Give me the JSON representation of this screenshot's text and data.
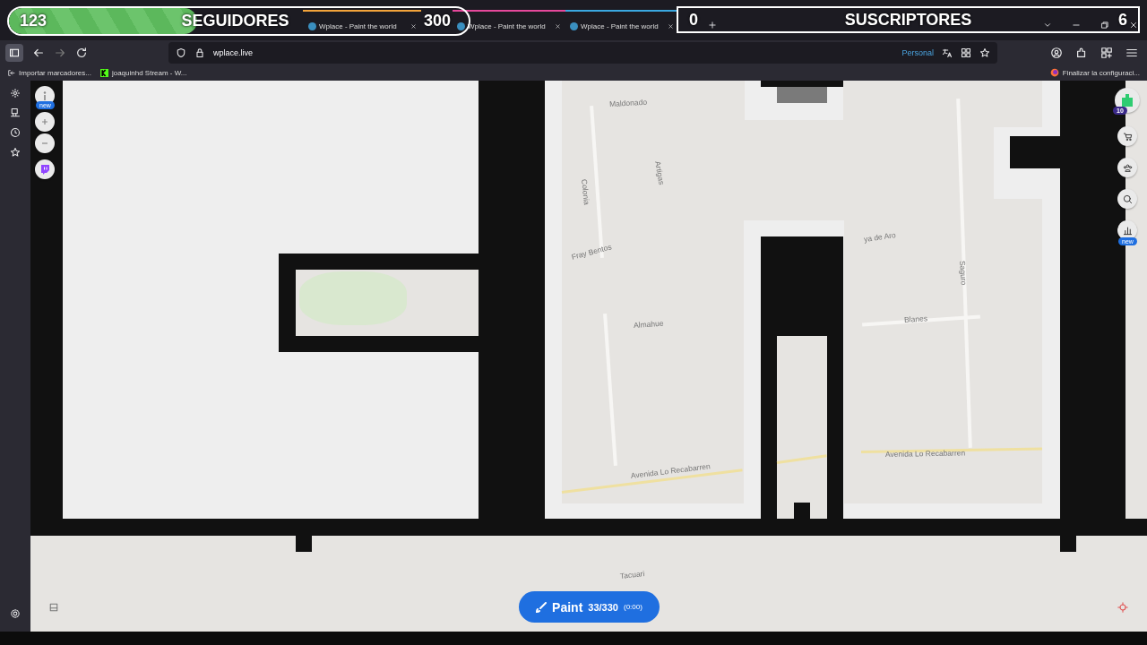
{
  "overlays": [
    {
      "count": "123",
      "label": "SEGUIDORES",
      "goal": "300",
      "level": 0.41,
      "kind": "pill"
    },
    {
      "count": "0",
      "label": "SUSCRIPTORES",
      "goal": "6",
      "kind": "box"
    }
  ],
  "tabs": [
    {
      "label": "Wplace - Paint the world",
      "selected": false,
      "color": "#f2a33a"
    },
    {
      "label": "Wplace - Paint the world",
      "selected": false,
      "color": "#e5489b"
    },
    {
      "label": "Wplace - Paint the world",
      "selected": false,
      "color": "#3aa8e0"
    }
  ],
  "toolbar": {
    "url": "wplace.live",
    "container": "Personal"
  },
  "bookmarks": [
    {
      "label": "Importar marcadores..."
    },
    {
      "label": "joaquinhd Stream - W..."
    }
  ],
  "setup_notice": "Finalizar la configuraci...",
  "map_labels": [
    "Maldonado",
    "Colonia",
    "Artigas",
    "Fray Bentos",
    "Almahue",
    "Avenida Lo Recabarren",
    "ya de Aro",
    "Saguro",
    "Blanes",
    "Avenida Lo Recabarren",
    "Tacuari"
  ],
  "left_controls": {
    "info_badge": "new"
  },
  "right_controls": {
    "logo_badge": "10",
    "stats_badge": "new"
  },
  "paint_button": {
    "label": "Paint",
    "charges": "33/330",
    "cooldown": "(0:00)"
  }
}
